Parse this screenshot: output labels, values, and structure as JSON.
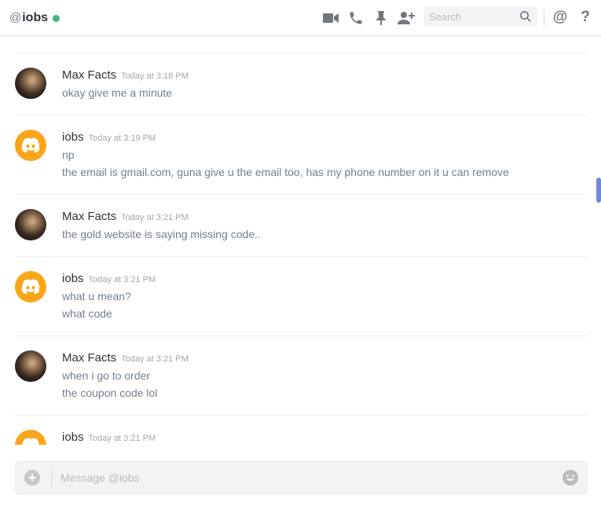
{
  "header": {
    "at_symbol": "@",
    "channel_name": "iobs",
    "search_placeholder": "Search",
    "mentions_label": "@",
    "help_label": "?"
  },
  "messages": [
    {
      "author": "Max Facts",
      "time": "Today at 3:18 PM",
      "avatar": "photo",
      "lines": [
        "okay give me a minute"
      ]
    },
    {
      "author": "iobs",
      "time": "Today at 3:19 PM",
      "avatar": "discord-logo",
      "lines": [
        "np",
        "the email is gmail.com, guna give u the email too, has my phone number on it u can remove"
      ]
    },
    {
      "author": "Max Facts",
      "time": "Today at 3:21 PM",
      "avatar": "photo",
      "lines": [
        "the gold website is saying missing code.."
      ]
    },
    {
      "author": "iobs",
      "time": "Today at 3:21 PM",
      "avatar": "discord-logo",
      "lines": [
        "what u mean?",
        "what code"
      ]
    },
    {
      "author": "Max Facts",
      "time": "Today at 3:21 PM",
      "avatar": "photo",
      "lines": [
        "when i go to order",
        "the coupon code lol"
      ]
    },
    {
      "author": "iobs",
      "time": "Today at 3:21 PM",
      "avatar": "discord-logo",
      "lines": []
    }
  ],
  "composer": {
    "placeholder": "Message @iobs",
    "add_label": "+"
  },
  "colors": {
    "online": "#43b581",
    "discord_avatar": "#faa61a",
    "scroll_thumb": "#7289da"
  }
}
